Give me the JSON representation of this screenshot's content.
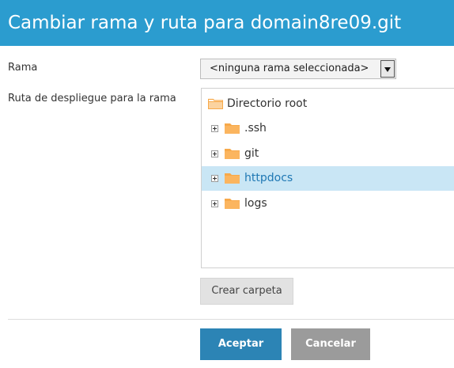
{
  "dialog": {
    "title": "Cambiar rama y ruta para domain8re09.git"
  },
  "form": {
    "branch_label": "Rama",
    "branch_select": {
      "selected": "<ninguna rama seleccionada>"
    },
    "path_label": "Ruta de despliegue para la rama"
  },
  "tree": {
    "root": {
      "label": "Directorio root",
      "icon": "folder-open-icon"
    },
    "items": [
      {
        "label": ".ssh",
        "expandable": true,
        "selected": false
      },
      {
        "label": "git",
        "expandable": true,
        "selected": false
      },
      {
        "label": "httpdocs",
        "expandable": true,
        "selected": true
      },
      {
        "label": "logs",
        "expandable": true,
        "selected": false
      }
    ]
  },
  "actions": {
    "create_folder": "Crear carpeta",
    "accept": "Aceptar",
    "cancel": "Cancelar"
  },
  "colors": {
    "header": "#2b9ccf",
    "selected_row": "#c9e6f5",
    "accept_button": "#2c84b5",
    "cancel_button": "#9b9b9b",
    "folder": "#f7a94a"
  }
}
